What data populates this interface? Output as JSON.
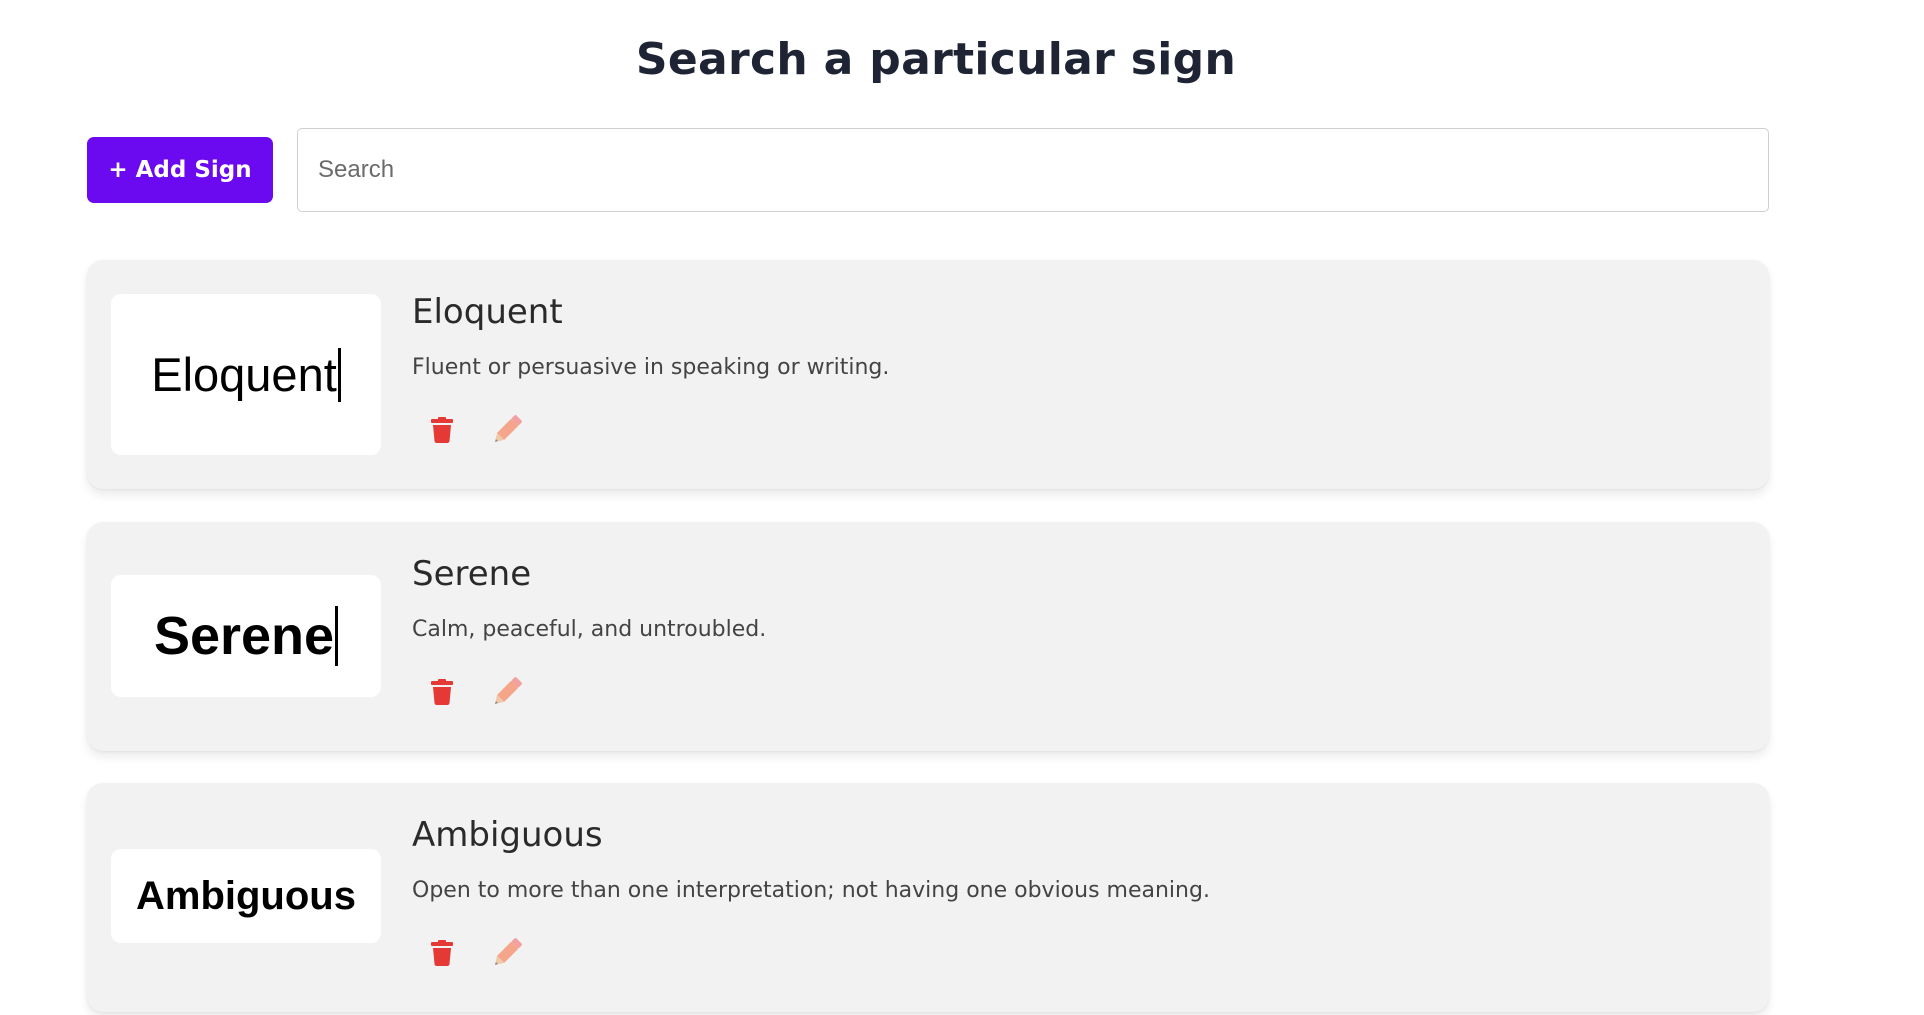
{
  "header": {
    "title": "Search a particular sign"
  },
  "toolbar": {
    "add_label": "+ Add Sign",
    "search_placeholder": "Search",
    "search_value": ""
  },
  "colors": {
    "accent": "#6b0af0",
    "delete": "#e53935",
    "edit": "#f4a58a",
    "card_bg": "#f2f2f2"
  },
  "signs": [
    {
      "preview_text": "Eloquent",
      "title": "Eloquent",
      "description": "Fluent or persuasive in speaking or writing.",
      "delete_icon": "trash-icon",
      "edit_icon": "pencil-icon"
    },
    {
      "preview_text": "Serene",
      "title": "Serene",
      "description": "Calm, peaceful, and untroubled.",
      "delete_icon": "trash-icon",
      "edit_icon": "pencil-icon"
    },
    {
      "preview_text": "Ambiguous",
      "title": "Ambiguous",
      "description": "Open to more than one interpretation; not having one obvious meaning.",
      "delete_icon": "trash-icon",
      "edit_icon": "pencil-icon"
    }
  ]
}
